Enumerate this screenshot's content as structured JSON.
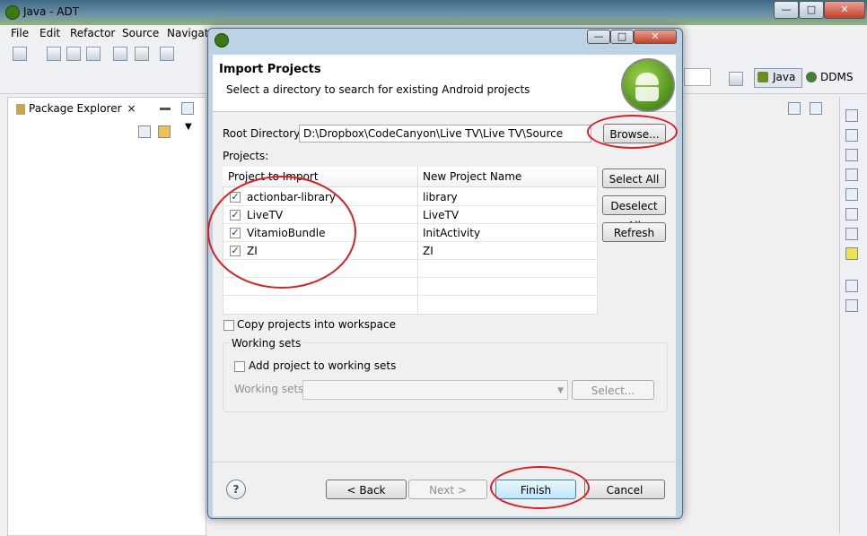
{
  "app": {
    "title": "Java - ADT"
  },
  "menu": [
    "File",
    "Edit",
    "Refactor",
    "Source",
    "Navigat"
  ],
  "perspectives": {
    "java": "Java",
    "ddms": "DDMS"
  },
  "left_view": {
    "tab_label": "Package Explorer"
  },
  "dialog": {
    "header_title": "Import Projects",
    "header_subtitle": "Select a directory to search for existing Android projects",
    "root_dir_label": "Root Directory:",
    "root_dir_value": "D:\\Dropbox\\CodeCanyon\\Live TV\\Live TV\\Source",
    "browse_label": "Browse...",
    "projects_label": "Projects:",
    "col_project": "Project to Import",
    "col_new_name": "New Project Name",
    "rows": [
      {
        "project": "actionbar-library",
        "new_name": "library",
        "checked": true
      },
      {
        "project": "LiveTV",
        "new_name": "LiveTV",
        "checked": true
      },
      {
        "project": "VitamioBundle",
        "new_name": "InitActivity",
        "checked": true
      },
      {
        "project": "ZI",
        "new_name": "ZI",
        "checked": true
      }
    ],
    "select_all": "Select All",
    "deselect_all": "Deselect All",
    "refresh": "Refresh",
    "copy_projects": "Copy projects into workspace",
    "working_sets_group": "Working sets",
    "add_to_working_sets": "Add project to working sets",
    "working_sets_label": "Working sets:",
    "working_sets_select": "Select...",
    "back": "< Back",
    "next": "Next >",
    "finish": "Finish",
    "cancel": "Cancel",
    "help_icon": "?"
  }
}
